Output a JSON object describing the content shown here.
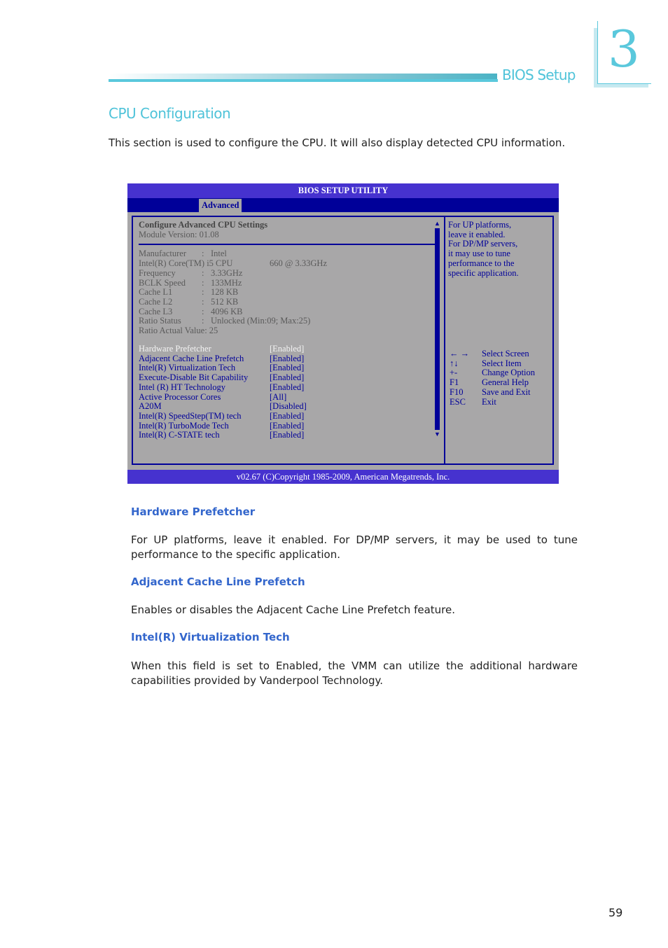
{
  "header": {
    "section_label": "BIOS Setup",
    "chapter_number": "3",
    "accent_color": "#5ac8dc"
  },
  "page": {
    "title": "CPU Configuration",
    "intro": "This section is used to configure the CPU. It will also display detected CPU information.",
    "page_number": "59"
  },
  "bios": {
    "title": "BIOS SETUP UTILITY",
    "active_tab": "Advanced",
    "heading": "Configure Advanced CPU Settings",
    "module_version": "Module Version: 01.08",
    "info": [
      {
        "label": "Manufacturer",
        "sep": ":",
        "value": "Intel"
      }
    ],
    "cpu_name": {
      "label": "Intel(R) Core(TM) i5 CPU",
      "value": "660 @ 3.33GHz"
    },
    "specs": [
      {
        "label": "Frequency",
        "sep": ":",
        "value": "3.33GHz"
      },
      {
        "label": "BCLK Speed",
        "sep": ":",
        "value": "133MHz"
      },
      {
        "label": "Cache L1",
        "sep": ":",
        "value": "128 KB"
      },
      {
        "label": "Cache L2",
        "sep": ":",
        "value": "512 KB"
      },
      {
        "label": "Cache L3",
        "sep": ":",
        "value": "4096 KB"
      },
      {
        "label": "Ratio Status",
        "sep": ":",
        "value": "Unlocked (Min:09; Max:25)"
      }
    ],
    "ratio_actual": "Ratio Actual Value: 25",
    "options": [
      {
        "label": "Hardware Prefetcher",
        "value": "[Enabled]"
      },
      {
        "label": "Adjacent Cache Line Prefetch",
        "value": "[Enabled]"
      },
      {
        "label": "Intel(R) Virtualization Tech",
        "value": "[Enabled]"
      },
      {
        "label": "Execute-Disable Bit Capability",
        "value": "[Enabled]"
      },
      {
        "label": "Intel (R) HT Technology",
        "value": "[Enabled]"
      },
      {
        "label": "Active Processor Cores",
        "value": "[All]"
      },
      {
        "label": "A20M",
        "value": "[Disabled]"
      },
      {
        "label": "Intel(R) SpeedStep(TM) tech",
        "value": "[Enabled]"
      },
      {
        "label": "Intel(R) TurboMode Tech",
        "value": "[Enabled]"
      },
      {
        "label": "Intel(R) C-STATE tech",
        "value": "[Enabled]"
      }
    ],
    "selected_option": "Hardware Prefetcher",
    "help_lines": [
      "For UP platforms,",
      "leave it enabled.",
      "For DP/MP servers,",
      "it may use to tune",
      "performance to the",
      "specific application."
    ],
    "keys": [
      {
        "key": "← →",
        "action": "Select Screen"
      },
      {
        "key": "↑↓",
        "action": "Select Item"
      },
      {
        "key": "+-",
        "action": "Change Option"
      },
      {
        "key": "F1",
        "action": "General Help"
      },
      {
        "key": "F10",
        "action": "Save and Exit"
      },
      {
        "key": "ESC",
        "action": "Exit"
      }
    ],
    "footer": "v02.67 (C)Copyright 1985-2009, American Megatrends, Inc.",
    "colors": {
      "title_bar": "#4632cf",
      "tab_bar": "#000099",
      "panel": "#a8a7a8",
      "text": "#000099"
    }
  },
  "descriptions": [
    {
      "heading": "Hardware Prefetcher",
      "text": "For UP platforms, leave it enabled. For DP/MP servers, it may be used to tune performance to the specific application."
    },
    {
      "heading": "Adjacent Cache Line Prefetch",
      "text": "Enables or disables the Adjacent Cache Line Prefetch feature."
    },
    {
      "heading": "Intel(R) Virtualization Tech",
      "text": "When this field is set to Enabled, the VMM can utilize the additional hardware capabilities provided by Vanderpool Technology."
    }
  ]
}
